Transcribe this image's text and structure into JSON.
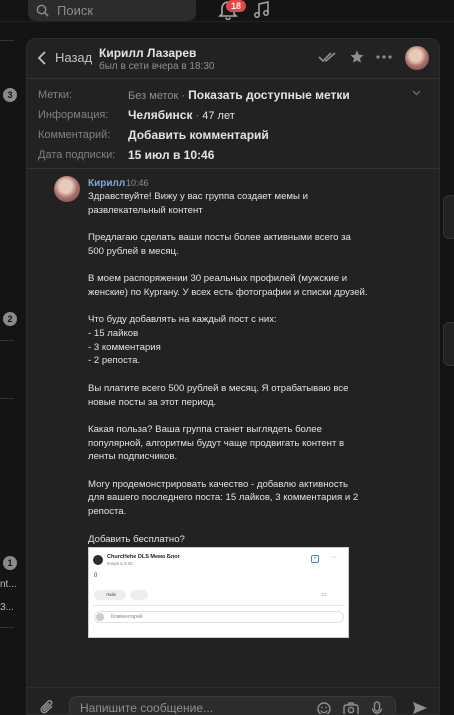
{
  "topbar": {
    "search_placeholder": "Поиск",
    "notifications_count": "18"
  },
  "left_strip": {
    "badges": [
      "3",
      "2",
      "1"
    ],
    "snippets": [
      "nt...",
      "3..."
    ]
  },
  "header": {
    "back_label": "Назад",
    "user_name": "Кирилл Лазарев",
    "user_status": "был в сети вчера в 18:30"
  },
  "info": {
    "tags_label": "Метки:",
    "tags_none": "Без меток",
    "tags_action": "Показать доступные метки",
    "about_label": "Информация:",
    "about_value": "Челябинск",
    "age_value": "47 лет",
    "comment_label": "Комментарий:",
    "comment_action": "Добавить комментарий",
    "subscribed_label": "Дата подписки:",
    "subscribed_value": "15 июл в 10:46"
  },
  "message": {
    "author": "Кирилл",
    "time": "10:46",
    "text": "Здравствуйте! Вижу у вас группа создает мемы и\nразвлекательный контент\n\nПредлагаю сделать ваши посты более активными всего за\n500 рублей в месяц.\n\nВ моем распоряжении 30 реальных профилей (мужские и\nженские) по Кургану. У всех есть фотографии и списки друзей.\n\nЧто буду добавлять на каждый пост с них:\n- 15 лайков\n- 3 комментария\n- 2 репоста.\n\nВы платите всего 500 рублей в месяц. Я отрабатываю все\nновые посты за этот период.\n\nКакая польза? Ваша группа станет выглядеть более\nпопулярной, алгоритмы будут чаще продвигать контент в\nленты подписчиков.\n\nМогу продемонстрировать качество - добавлю активность\nдля вашего последнего поста: 15 лайков, 3 комментария и 2\nрепоста.\n\nДобавить бесплатно?"
  },
  "attachment": {
    "group_name": "ChurcHehe DLS Мемо Блог",
    "date": "вчера в 3:35",
    "post_text": "0",
    "like_label": "Лайк",
    "views": "13",
    "comment_placeholder": "Комментарий"
  },
  "composer": {
    "placeholder": "Напишите сообщение..."
  },
  "colors": {
    "background": "#141414",
    "panel": "#222222",
    "accent": "#71aaeb",
    "badge": "#e64646"
  }
}
